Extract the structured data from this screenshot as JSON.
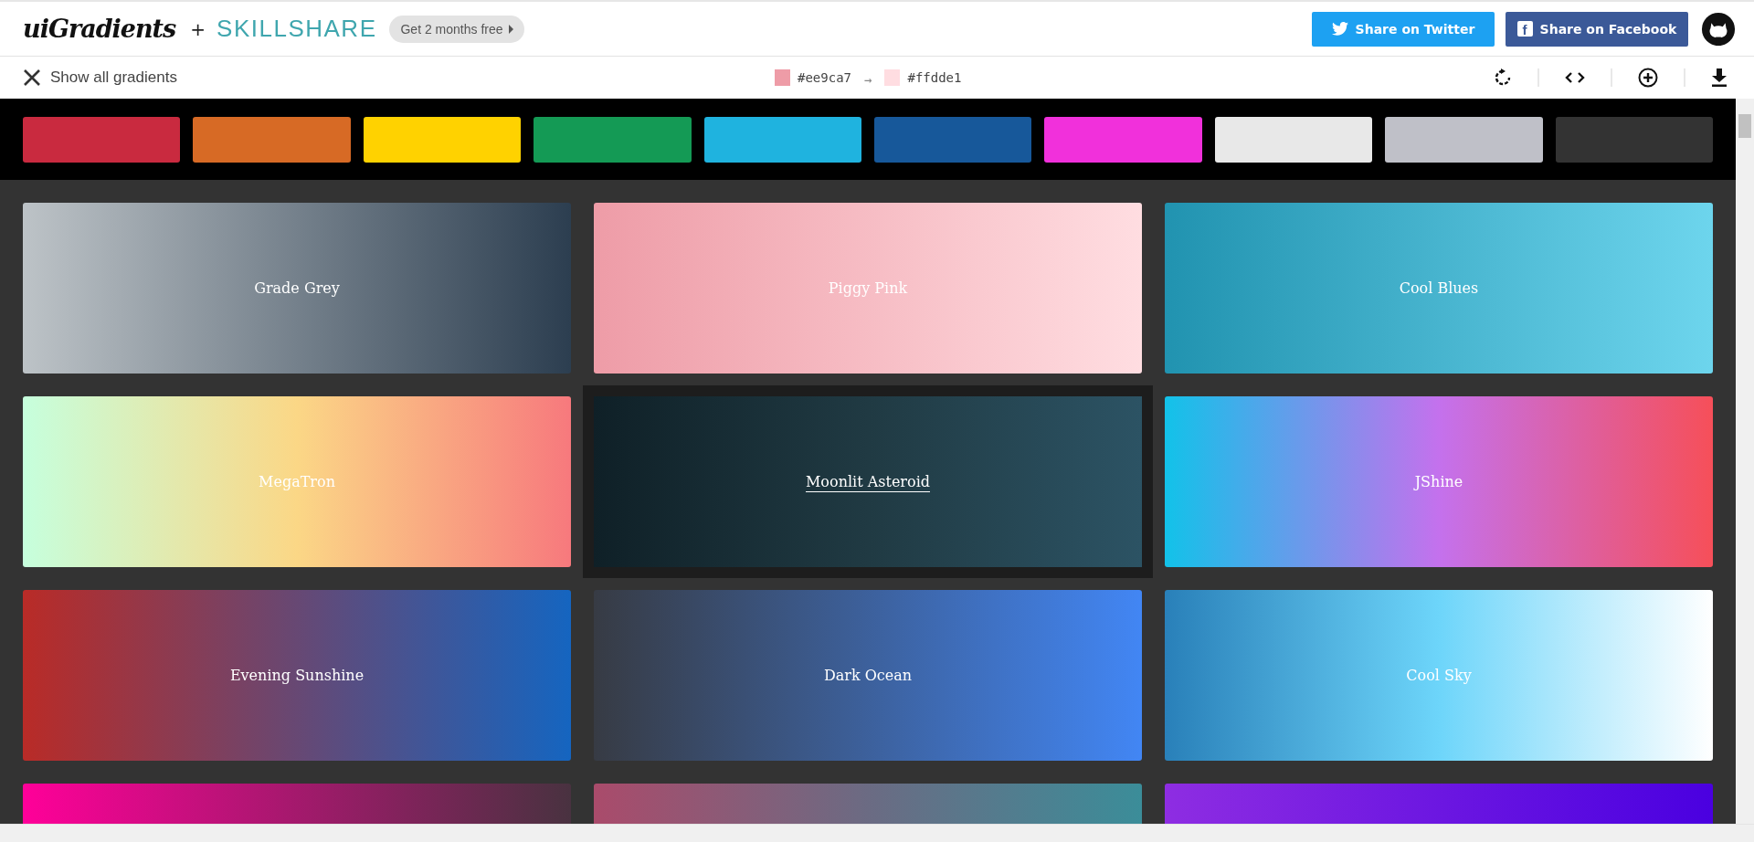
{
  "header": {
    "logo": "uiGradients",
    "plus": "+",
    "partner": "SKILLSHARE",
    "promo": "Get 2 months free",
    "buttons": [
      {
        "kind": "twitter",
        "label": "Share on Twitter"
      },
      {
        "kind": "facebook",
        "label": "Share on Facebook",
        "glyph": "f"
      }
    ]
  },
  "toolbar": {
    "back_label": "Show all gradients",
    "from": {
      "color": "#ee9ca7",
      "label": "#ee9ca7"
    },
    "arrow": "→",
    "to": {
      "color": "#ffdde1",
      "label": "#ffdde1"
    },
    "actions": [
      {
        "kind": "rotate"
      },
      {
        "kind": "code"
      },
      {
        "kind": "add"
      },
      {
        "kind": "download"
      }
    ]
  },
  "filters": [
    {
      "color": "#c92a3f"
    },
    {
      "color": "#d76a25"
    },
    {
      "color": "#ffd200"
    },
    {
      "color": "#149a55"
    },
    {
      "color": "#1fb3df"
    },
    {
      "color": "#17589a"
    },
    {
      "color": "#f130db"
    },
    {
      "color": "#e8e8e8"
    },
    {
      "color": "#bfc0c8"
    },
    {
      "color": "#333333"
    }
  ],
  "cards": [
    {
      "name": "Grade Grey",
      "stops": [
        {
          "color": "#bdc3c7"
        },
        {
          "color": "#2c3e50"
        }
      ],
      "hovered": false
    },
    {
      "name": "Piggy Pink",
      "stops": [
        {
          "color": "#ee9ca7"
        },
        {
          "color": "#ffdde1"
        }
      ],
      "hovered": false
    },
    {
      "name": "Cool Blues",
      "stops": [
        {
          "color": "#2193b0"
        },
        {
          "color": "#6dd5ed"
        }
      ],
      "hovered": false
    },
    {
      "name": "MegaTron",
      "stops": [
        {
          "color": "#c6ffdd"
        },
        {
          "color": "#fbd786"
        },
        {
          "color": "#f7797d"
        }
      ],
      "hovered": false
    },
    {
      "name": "Moonlit Asteroid",
      "stops": [
        {
          "color": "#0f2027"
        },
        {
          "color": "#203a43"
        },
        {
          "color": "#2c5364"
        }
      ],
      "hovered": true
    },
    {
      "name": "JShine",
      "stops": [
        {
          "color": "#12c2e9"
        },
        {
          "color": "#c471ed"
        },
        {
          "color": "#f64f59"
        }
      ],
      "hovered": false
    },
    {
      "name": "Evening Sunshine",
      "stops": [
        {
          "color": "#b92b27"
        },
        {
          "color": "#1565c0"
        }
      ],
      "hovered": false
    },
    {
      "name": "Dark Ocean",
      "stops": [
        {
          "color": "#373b44"
        },
        {
          "color": "#4286f4"
        }
      ],
      "hovered": false
    },
    {
      "name": "Cool Sky",
      "stops": [
        {
          "color": "#2980b9"
        },
        {
          "color": "#6dd5fa"
        },
        {
          "color": "#ffffff"
        }
      ],
      "hovered": false
    },
    {
      "stops": [
        {
          "color": "#ff0099"
        },
        {
          "color": "#493240"
        }
      ],
      "hovered": false
    },
    {
      "stops": [
        {
          "color": "#aa4b6b"
        },
        {
          "color": "#6b6b83"
        },
        {
          "color": "#3b8d99"
        }
      ],
      "hovered": false
    },
    {
      "stops": [
        {
          "color": "#8e2de2"
        },
        {
          "color": "#4a00e0"
        }
      ],
      "hovered": false
    }
  ]
}
